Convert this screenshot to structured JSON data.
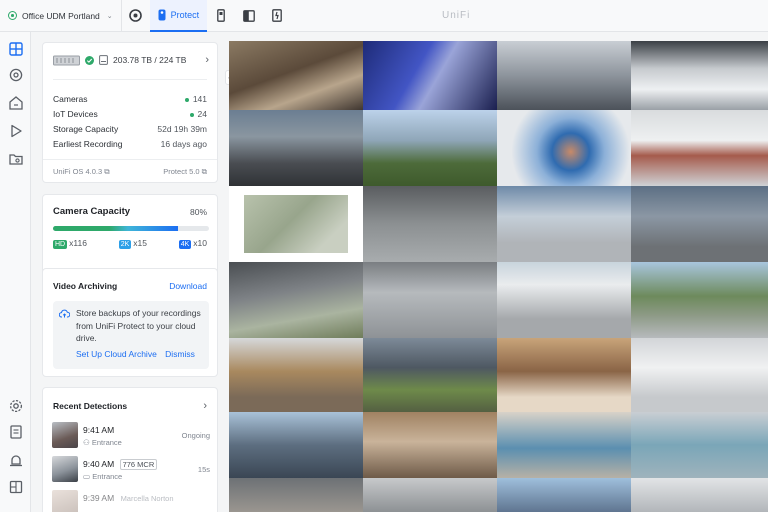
{
  "topbar": {
    "site_name": "Office UDM Portland",
    "active_app": "Protect",
    "brand": "UniFi"
  },
  "storage": {
    "summary": "203.78 TB / 224 TB",
    "stats": [
      {
        "label": "Cameras",
        "value": "141",
        "dot": true
      },
      {
        "label": "IoT Devices",
        "value": "24",
        "dot": true
      },
      {
        "label": "Storage Capacity",
        "value": "52d 19h 39m",
        "dot": false
      },
      {
        "label": "Earliest Recording",
        "value": "16 days ago",
        "dot": false
      }
    ],
    "os_version": "UniFi OS 4.0.3",
    "protect_version": "Protect 5.0"
  },
  "capacity": {
    "title": "Camera Capacity",
    "percent": "80%",
    "fill_fraction": 0.8,
    "hd": {
      "badge": "HD",
      "count": "x116"
    },
    "k2": {
      "badge": "2K",
      "count": "x15"
    },
    "k4": {
      "badge": "4K",
      "count": "x10"
    }
  },
  "archiving": {
    "title": "Video Archiving",
    "download": "Download",
    "text": "Store backups of your recordings from UniFi Protect to your cloud drive.",
    "setup_link": "Set Up Cloud Archive",
    "dismiss": "Dismiss"
  },
  "detections": {
    "title": "Recent Detections",
    "items": [
      {
        "time": "9:41 AM",
        "plate": "",
        "name": "",
        "camera": "Entrance",
        "status": "Ongoing"
      },
      {
        "time": "9:40 AM",
        "plate": "776 MCR",
        "name": "",
        "camera": "Entrance",
        "status": "15s"
      },
      {
        "time": "9:39 AM",
        "plate": "",
        "name": "Marcella Norton",
        "camera": "",
        "status": ""
      }
    ]
  },
  "colors": {
    "accent": "#1c6ef2",
    "online": "#2ea96a",
    "hd": "#2ea96a",
    "k2": "#2ea0e8",
    "k4": "#1c6ef2"
  }
}
